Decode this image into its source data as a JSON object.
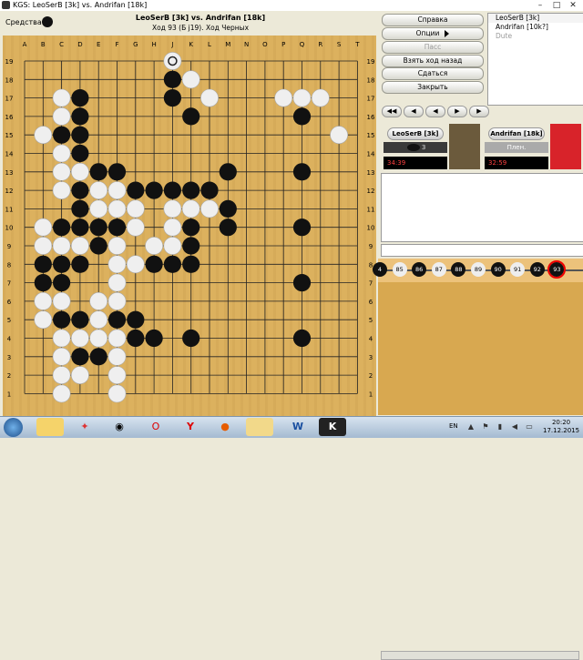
{
  "window": {
    "title": "KGS: LeoSerB [3k] vs. Andrifan [18k]"
  },
  "info": {
    "stones_label": "Средства:",
    "game_title": "LeoSerB [3k] vs. Andrifan [18k]",
    "status": "Ход 93 (Б j19). Ход Черных"
  },
  "board": {
    "columns": [
      "A",
      "B",
      "C",
      "D",
      "E",
      "F",
      "G",
      "H",
      "J",
      "K",
      "L",
      "M",
      "N",
      "O",
      "P",
      "Q",
      "R",
      "S",
      "T"
    ],
    "rows": [
      "19",
      "18",
      "17",
      "16",
      "15",
      "14",
      "13",
      "12",
      "11",
      "10",
      "9",
      "8",
      "7",
      "6",
      "5",
      "4",
      "3",
      "2",
      "1"
    ],
    "black": [
      "J18",
      "J17",
      "K16",
      "Q16",
      "D17",
      "D16",
      "D15",
      "D14",
      "C15",
      "C13",
      "E13",
      "F13",
      "Q17",
      "M13",
      "Q13",
      "D12",
      "D11",
      "F12",
      "G12",
      "H12",
      "J12",
      "K12",
      "L12",
      "M11",
      "K11",
      "D10",
      "C10",
      "E10",
      "F10",
      "K10",
      "M10",
      "Q10",
      "E9",
      "K9",
      "H8",
      "J8",
      "K8",
      "B8",
      "C8",
      "D8",
      "B7",
      "C7",
      "Q7",
      "C6",
      "B6",
      "C5",
      "D5",
      "F5",
      "G5",
      "E5",
      "G4",
      "H4",
      "K4",
      "Q4",
      "D4",
      "D3",
      "E3",
      "F3",
      "C2"
    ],
    "white": [
      "J19",
      "K18",
      "C17",
      "C16",
      "B15",
      "C14",
      "D13",
      "C12",
      "E12",
      "E11",
      "F11",
      "G11",
      "J11",
      "K11",
      "L11",
      "E12",
      "F12",
      "B10",
      "G10",
      "J10",
      "C9",
      "D9",
      "F9",
      "H9",
      "J9",
      "G8",
      "F7",
      "B6",
      "F6",
      "B5",
      "E5",
      "E4",
      "F4",
      "C4",
      "C3",
      "F3",
      "C2",
      "D2",
      "F2",
      "C1",
      "F1",
      "S15",
      "R17",
      "Q17",
      "P17",
      "L17",
      "K18",
      "C13",
      "B10",
      "B9",
      "F8",
      "C6",
      "E6",
      "D4"
    ],
    "last_move": "J19"
  },
  "menu": {
    "help": "Справка",
    "options": "Опции",
    "pass": "Пасс",
    "undo": "Взять ход назад",
    "resign": "Сдаться",
    "close": "Закрыть"
  },
  "users": [
    "LeoSerB [3k]",
    "Andrifan [10k?]",
    "Dute"
  ],
  "players": {
    "black": {
      "name": "LeoSerB [3k]",
      "captures": "3",
      "time": "34:39"
    },
    "white": {
      "name": "Andrifan [18k]",
      "captures": "Плен.",
      "time": "32:59"
    }
  },
  "tree": {
    "nodes": [
      {
        "label": "4",
        "color": "b"
      },
      {
        "label": "85",
        "color": "w"
      },
      {
        "label": "86",
        "color": "b"
      },
      {
        "label": "87",
        "color": "w"
      },
      {
        "label": "88",
        "color": "b"
      },
      {
        "label": "89",
        "color": "w"
      },
      {
        "label": "90",
        "color": "b"
      },
      {
        "label": "91",
        "color": "w"
      },
      {
        "label": "92",
        "color": "b"
      },
      {
        "label": "93",
        "color": "cur"
      }
    ]
  },
  "taskbar": {
    "apps": [
      "explorer-icon",
      "windows-icon",
      "chrome-icon",
      "opera-icon",
      "yandex-icon",
      "firefox-icon",
      "files-icon",
      "word-icon",
      "kgs-icon"
    ],
    "lang": "EN",
    "time": "20:20",
    "date": "17.12.2015"
  },
  "colors": {
    "board": "#dcb15e",
    "black_stone": "#111111",
    "white_stone": "#eeeeee",
    "last_move_marker": "#ff0000"
  }
}
